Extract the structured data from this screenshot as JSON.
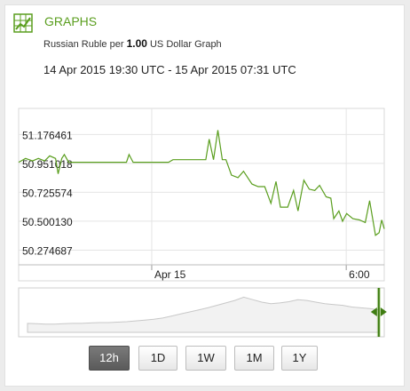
{
  "header": {
    "title": "GRAPHS",
    "icon": "bar-chart-icon",
    "accent": "#5a9e1e"
  },
  "subtitle": {
    "prefix": "Russian Ruble per",
    "amount": "1.00",
    "suffix": "US Dollar Graph"
  },
  "date_range": "14 Apr 2015 19:30 UTC - 15 Apr 2015 07:31 UTC",
  "timeframes": [
    {
      "label": "12h",
      "active": true
    },
    {
      "label": "1D",
      "active": false
    },
    {
      "label": "1W",
      "active": false
    },
    {
      "label": "1M",
      "active": false
    },
    {
      "label": "1Y",
      "active": false
    }
  ],
  "chart_data": {
    "type": "line",
    "series_color": "#5a9e1e",
    "y_ticks": [
      "51.176461",
      "50.951018",
      "50.725574",
      "50.500130",
      "50.274687"
    ],
    "y_tick_values": [
      51.176461,
      50.951018,
      50.725574,
      50.50013,
      50.274687
    ],
    "ylim": [
      50.16,
      51.38
    ],
    "x_ticks": [
      {
        "label": "Apr 15",
        "t": 0.364
      },
      {
        "label": "6:00",
        "t": 0.896
      }
    ],
    "grid": true,
    "series": [
      {
        "values": [
          [
            0.0,
            50.96
          ],
          [
            0.019,
            50.99
          ],
          [
            0.038,
            50.97
          ],
          [
            0.054,
            50.99
          ],
          [
            0.071,
            50.97
          ],
          [
            0.085,
            51.01
          ],
          [
            0.101,
            50.99
          ],
          [
            0.108,
            50.87
          ],
          [
            0.118,
            50.99
          ],
          [
            0.125,
            51.02
          ],
          [
            0.137,
            50.96
          ],
          [
            0.255,
            50.96
          ],
          [
            0.295,
            50.96
          ],
          [
            0.302,
            51.02
          ],
          [
            0.313,
            50.96
          ],
          [
            0.41,
            50.96
          ],
          [
            0.422,
            50.98
          ],
          [
            0.512,
            50.98
          ],
          [
            0.521,
            51.14
          ],
          [
            0.533,
            50.98
          ],
          [
            0.545,
            51.21
          ],
          [
            0.557,
            50.98
          ],
          [
            0.567,
            50.98
          ],
          [
            0.582,
            50.86
          ],
          [
            0.6,
            50.84
          ],
          [
            0.615,
            50.89
          ],
          [
            0.638,
            50.79
          ],
          [
            0.655,
            50.77
          ],
          [
            0.673,
            50.77
          ],
          [
            0.69,
            50.64
          ],
          [
            0.704,
            50.81
          ],
          [
            0.716,
            50.61
          ],
          [
            0.736,
            50.61
          ],
          [
            0.752,
            50.74
          ],
          [
            0.764,
            50.58
          ],
          [
            0.78,
            50.82
          ],
          [
            0.795,
            50.75
          ],
          [
            0.81,
            50.74
          ],
          [
            0.823,
            50.78
          ],
          [
            0.841,
            50.69
          ],
          [
            0.854,
            50.68
          ],
          [
            0.862,
            50.52
          ],
          [
            0.876,
            50.58
          ],
          [
            0.886,
            50.5
          ],
          [
            0.897,
            50.56
          ],
          [
            0.914,
            50.52
          ],
          [
            0.932,
            50.51
          ],
          [
            0.948,
            50.49
          ],
          [
            0.96,
            50.66
          ],
          [
            0.976,
            50.39
          ],
          [
            0.986,
            50.41
          ],
          [
            0.993,
            50.51
          ],
          [
            1.0,
            50.44
          ]
        ]
      }
    ]
  },
  "navigator": {
    "series": [
      0.22,
      0.21,
      0.2,
      0.2,
      0.21,
      0.22,
      0.22,
      0.23,
      0.24,
      0.24,
      0.25,
      0.26,
      0.28,
      0.3,
      0.32,
      0.35,
      0.4,
      0.45,
      0.5,
      0.55,
      0.6,
      0.66,
      0.72,
      0.78,
      0.86,
      0.8,
      0.74,
      0.7,
      0.72,
      0.75,
      0.8,
      0.78,
      0.74,
      0.7,
      0.68,
      0.66,
      0.62,
      0.6,
      0.58,
      0.55
    ],
    "selection_start": 0.985
  }
}
